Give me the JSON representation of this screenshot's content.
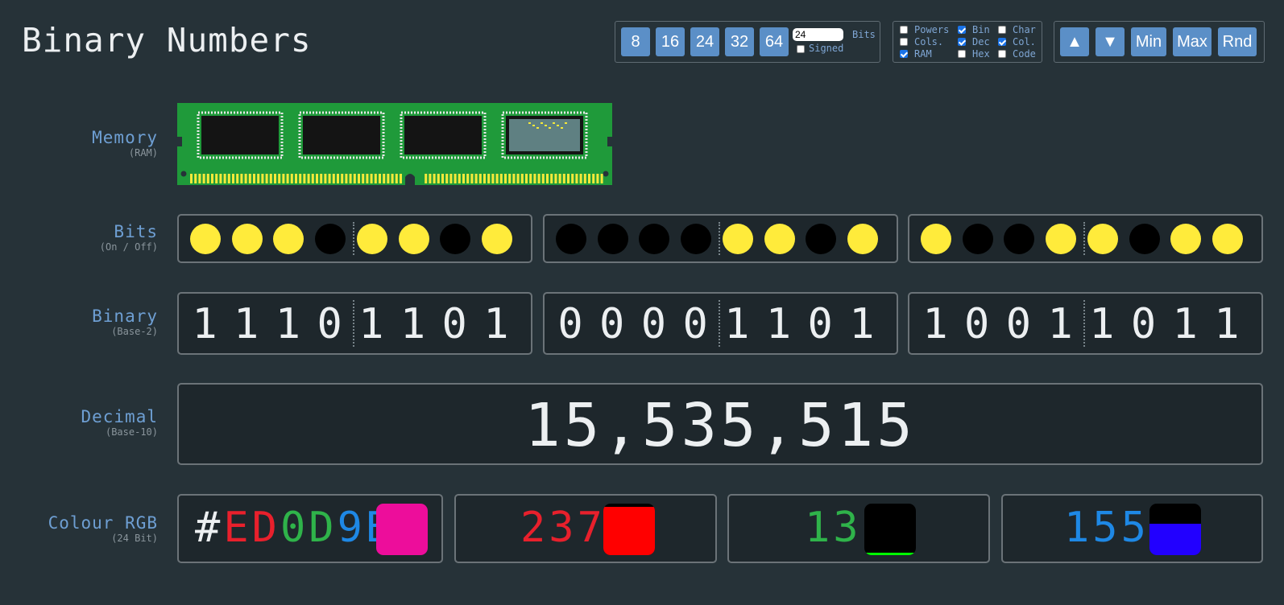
{
  "title": "Binary Numbers",
  "bit_controls": {
    "buttons": [
      "8",
      "16",
      "24",
      "32",
      "64"
    ],
    "bits_value": "24",
    "bits_label": "Bits",
    "signed_label": "Signed",
    "signed_checked": false
  },
  "options": [
    {
      "label": "Powers",
      "checked": false
    },
    {
      "label": "Cols.",
      "checked": false
    },
    {
      "label": "RAM",
      "checked": true
    },
    {
      "label": "Bin",
      "checked": true
    },
    {
      "label": "Dec",
      "checked": true
    },
    {
      "label": "Hex",
      "checked": false
    },
    {
      "label": "Char",
      "checked": false
    },
    {
      "label": "Col.",
      "checked": true
    },
    {
      "label": "Code",
      "checked": false
    }
  ],
  "actions": {
    "up_icon": "triangle-up",
    "down_icon": "triangle-down",
    "up": "▲",
    "down": "▼",
    "min": "Min",
    "max": "Max",
    "rnd": "Rnd"
  },
  "rows": {
    "memory": {
      "label": "Memory",
      "sub": "(RAM)"
    },
    "bits": {
      "label": "Bits",
      "sub": "(On / Off)"
    },
    "binary": {
      "label": "Binary",
      "sub": "(Base-2)"
    },
    "decimal": {
      "label": "Decimal",
      "sub": "(Base-10)"
    },
    "colour": {
      "label": "Colour RGB",
      "sub": "(24 Bit)"
    }
  },
  "bytes": [
    [
      "1",
      "1",
      "1",
      "0",
      "1",
      "1",
      "0",
      "1"
    ],
    [
      "0",
      "0",
      "0",
      "0",
      "1",
      "1",
      "0",
      "1"
    ],
    [
      "1",
      "0",
      "0",
      "1",
      "1",
      "0",
      "1",
      "1"
    ]
  ],
  "decimal_value": "15,535,515",
  "colour": {
    "hash": "#",
    "hex_r": "ED",
    "hex_g": "0D",
    "hex_b": "9B",
    "swatch_color": "#ED0D9B",
    "r": "237",
    "g": "13",
    "b": "155",
    "r_color": "#e8202c",
    "g_color": "#2fb34a",
    "b_color": "#1e88e5",
    "r_fraction": 0.93,
    "g_fraction": 0.05,
    "b_fraction": 0.61
  },
  "colors": {
    "background": "#263238",
    "bit_on": "#FFEB3B",
    "bit_off": "#000000",
    "button": "#5b8fc7",
    "ram_board": "#1f9a3a"
  }
}
